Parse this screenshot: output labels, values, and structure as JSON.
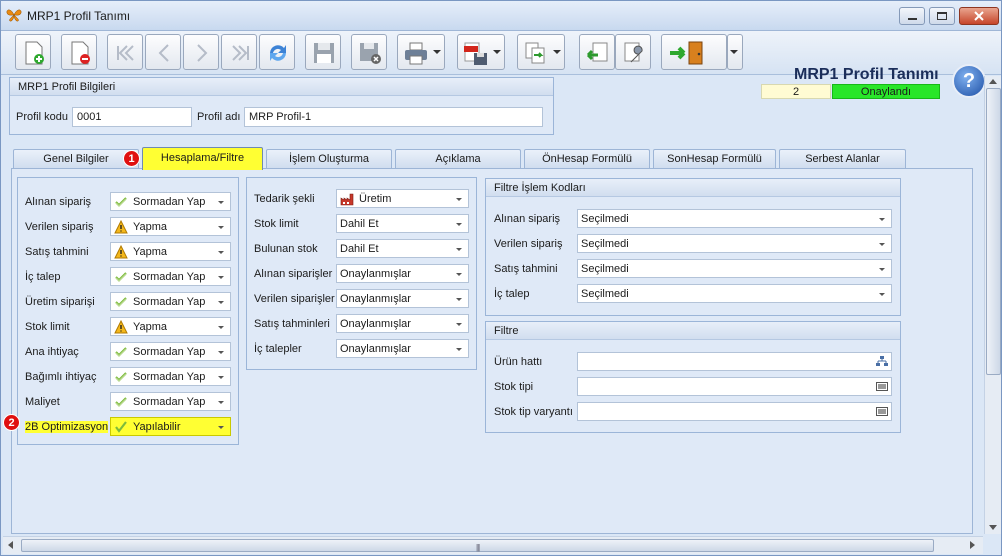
{
  "window": {
    "title": "MRP1 Profil Tanımı"
  },
  "header": {
    "form_title": "MRP1 Profil Tanımı",
    "record_no": "2",
    "status": "Onaylandı",
    "status_color": "#29e629",
    "help_label": "?"
  },
  "toolbar": {
    "buttons": [
      "new-document",
      "delete-document",
      "first-record",
      "previous-record",
      "next-record",
      "last-record",
      "refresh",
      "save",
      "save-and-close",
      "print",
      "export-pdf",
      "copy",
      "import",
      "tools",
      "exit"
    ]
  },
  "profile": {
    "title": "MRP1 Profil Bilgileri",
    "code_label": "Profil kodu",
    "code_value": "0001",
    "name_label": "Profil adı",
    "name_value": "MRP Profil-1"
  },
  "tabs": [
    "Genel Bilgiler",
    "Hesaplama/Filtre",
    "İşlem Oluşturma",
    "Açıklama",
    "ÖnHesap Formülü",
    "SonHesap Formülü",
    "Serbest Alanlar"
  ],
  "active_tab_index": 1,
  "badges": {
    "one": "1",
    "two": "2"
  },
  "calc": {
    "rows": [
      {
        "label": "Alınan sipariş",
        "value": "Sormadan Yap",
        "icon": "check-icon"
      },
      {
        "label": "Verilen sipariş",
        "value": "Yapma",
        "icon": "warning-icon"
      },
      {
        "label": "Satış tahmini",
        "value": "Yapma",
        "icon": "warning-icon"
      },
      {
        "label": "İç talep",
        "value": "Sormadan Yap",
        "icon": "check-icon"
      },
      {
        "label": "Üretim siparişi",
        "value": "Sormadan Yap",
        "icon": "check-icon"
      },
      {
        "label": "Stok limit",
        "value": "Yapma",
        "icon": "warning-icon"
      },
      {
        "label": "Ana ihtiyaç",
        "value": "Sormadan Yap",
        "icon": "check-icon"
      },
      {
        "label": "Bağımlı ihtiyaç",
        "value": "Sormadan Yap",
        "icon": "check-icon"
      },
      {
        "label": "Maliyet",
        "value": "Sormadan Yap",
        "icon": "check-icon"
      },
      {
        "label": "2B Optimizasyon",
        "value": "Yapılabilir",
        "icon": "tick-icon"
      }
    ]
  },
  "supply": {
    "rows": [
      {
        "label": "Tedarik şekli",
        "value": "Üretim",
        "icon": "factory-icon"
      },
      {
        "label": "Stok limit",
        "value": "Dahil Et"
      },
      {
        "label": "Bulunan stok",
        "value": "Dahil Et"
      },
      {
        "label": "Alınan siparişler",
        "value": "Onaylanmışlar"
      },
      {
        "label": "Verilen siparişler",
        "value": "Onaylanmışlar"
      },
      {
        "label": "Satış tahminleri",
        "value": "Onaylanmışlar"
      },
      {
        "label": "İç talepler",
        "value": "Onaylanmışlar"
      }
    ]
  },
  "filter_codes": {
    "title": "Filtre İşlem Kodları",
    "rows": [
      {
        "label": "Alınan sipariş",
        "value": "Seçilmedi"
      },
      {
        "label": "Verilen sipariş",
        "value": "Seçilmedi"
      },
      {
        "label": "Satış tahmini",
        "value": "Seçilmedi"
      },
      {
        "label": "İç talep",
        "value": "Seçilmedi"
      }
    ]
  },
  "filter": {
    "title": "Filtre",
    "rows": [
      {
        "label": "Ürün hattı",
        "value": ""
      },
      {
        "label": "Stok tipi",
        "value": ""
      },
      {
        "label": "Stok tip varyantı",
        "value": ""
      }
    ]
  },
  "scrollbar": {
    "grip": "|||"
  }
}
